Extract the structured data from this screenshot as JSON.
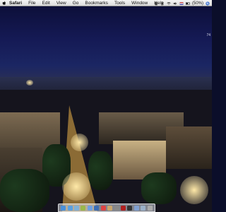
{
  "menubar": {
    "app_name": "Safari",
    "items": [
      "File",
      "Edit",
      "View",
      "Go",
      "Bookmarks",
      "Tools",
      "Window",
      "Help"
    ],
    "status": {
      "battery": "(50%)",
      "icons": [
        "script-icon",
        "bluetooth-icon",
        "wifi-icon",
        "volume-icon",
        "flag-icon",
        "battery-icon",
        "spotlight-icon"
      ]
    }
  },
  "desktop": {
    "corner_text": "74"
  },
  "dock": {
    "items": [
      "finder-icon",
      "safari-icon",
      "mail-icon",
      "ichat-icon",
      "itunes-icon",
      "iphoto-icon",
      "calendar-icon",
      "address-book-icon",
      "preferences-icon",
      "app-icon",
      "terminal-icon",
      "folder-icon",
      "documents-icon",
      "trash-icon"
    ],
    "colors": [
      "#4a90d9",
      "#5aa0e0",
      "#7fb0d8",
      "#9ab84a",
      "#6fa0e0",
      "#3d6eb4",
      "#d44",
      "#c9a56a",
      "#888",
      "#b02020",
      "#333",
      "#7f9fd0",
      "#9ab0c8",
      "#aaa"
    ]
  }
}
